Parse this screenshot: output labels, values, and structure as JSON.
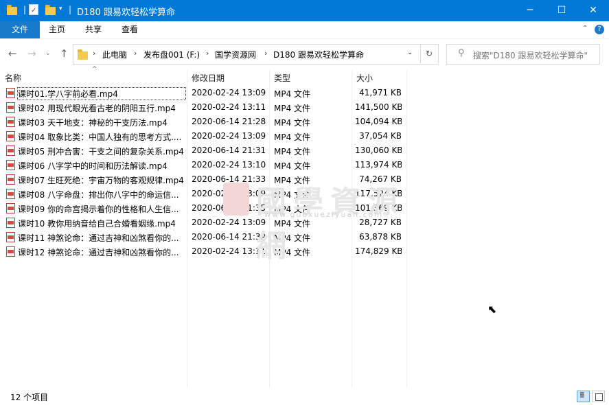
{
  "window": {
    "title": "D180 跟易欢轻松学算命"
  },
  "ribbon": {
    "tabs": [
      "文件",
      "主页",
      "共享",
      "查看"
    ]
  },
  "address": {
    "crumbs": [
      "此电脑",
      "发布盘001 (F:)",
      "国学资源网",
      "D180 跟易欢轻松学算命"
    ],
    "search_placeholder": "搜索\"D180 跟易欢轻松学算命\""
  },
  "columns": {
    "name": "名称",
    "date": "修改日期",
    "type": "类型",
    "size": "大小"
  },
  "files": [
    {
      "name": "课时01.学八字前必看.mp4",
      "date": "2020-02-24 13:09",
      "type": "MP4 文件",
      "size": "41,971 KB"
    },
    {
      "name": "课时02 用现代眼光看古老的阴阳五行.mp4",
      "date": "2020-02-24 13:11",
      "type": "MP4 文件",
      "size": "141,500 KB"
    },
    {
      "name": "课时03 天干地支：神秘的干支历法.mp4",
      "date": "2020-06-14 21:28",
      "type": "MP4 文件",
      "size": "104,094 KB"
    },
    {
      "name": "课时04 取象比类：中国人独有的思考方式....",
      "date": "2020-02-24 13:09",
      "type": "MP4 文件",
      "size": "37,054 KB"
    },
    {
      "name": "课时05 刑冲合害：干支之间的复杂关系.mp4",
      "date": "2020-06-14 21:31",
      "type": "MP4 文件",
      "size": "130,060 KB"
    },
    {
      "name": "课时06 八字学中的时间和历法解读.mp4",
      "date": "2020-02-24 13:10",
      "type": "MP4 文件",
      "size": "113,974 KB"
    },
    {
      "name": "课时07 生旺死绝：宇宙万物的客观规律.mp4",
      "date": "2020-06-14 21:33",
      "type": "MP4 文件",
      "size": "74,267 KB"
    },
    {
      "name": "课时08 八字命盘：排出你八字中的命运信...",
      "date": "2020-02-24 13:09",
      "type": "MP4 文件",
      "size": "117,524 KB"
    },
    {
      "name": "课时09 你的命宫揭示着你的性格和人生信...",
      "date": "2020-06-14 21:35",
      "type": "MP4 文件",
      "size": "101,369 KB"
    },
    {
      "name": "课时10 教你用纳音给自己合婚看姻缘.mp4",
      "date": "2020-02-24 13:09",
      "type": "MP4 文件",
      "size": "28,727 KB"
    },
    {
      "name": "课时11 神煞论命：通过吉神和凶煞看你的...",
      "date": "2020-06-14 21:39",
      "type": "MP4 文件",
      "size": "63,878 KB"
    },
    {
      "name": "课时12 神煞论命：通过吉神和凶煞看你的...",
      "date": "2020-02-24 13:11",
      "type": "MP4 文件",
      "size": "174,829 KB"
    }
  ],
  "watermark": {
    "big": "國學資源網",
    "small": "www.guoxueziyuan.com"
  },
  "status": {
    "count": "12 个项目"
  },
  "icons": [
    "folder-icon",
    "properties-icon",
    "new-folder-icon",
    "dropdown-icon",
    "minimize-icon",
    "maximize-icon",
    "close-icon",
    "chevron-up-icon",
    "help-icon",
    "back-icon",
    "forward-icon",
    "recent-icon",
    "up-icon",
    "refresh-icon",
    "search-icon",
    "mp4-file-icon",
    "mouse-cursor-icon",
    "details-view-icon",
    "tiles-view-icon"
  ],
  "colors": {
    "titlebar": "#0078d7",
    "file_tab": "#1979ca"
  }
}
